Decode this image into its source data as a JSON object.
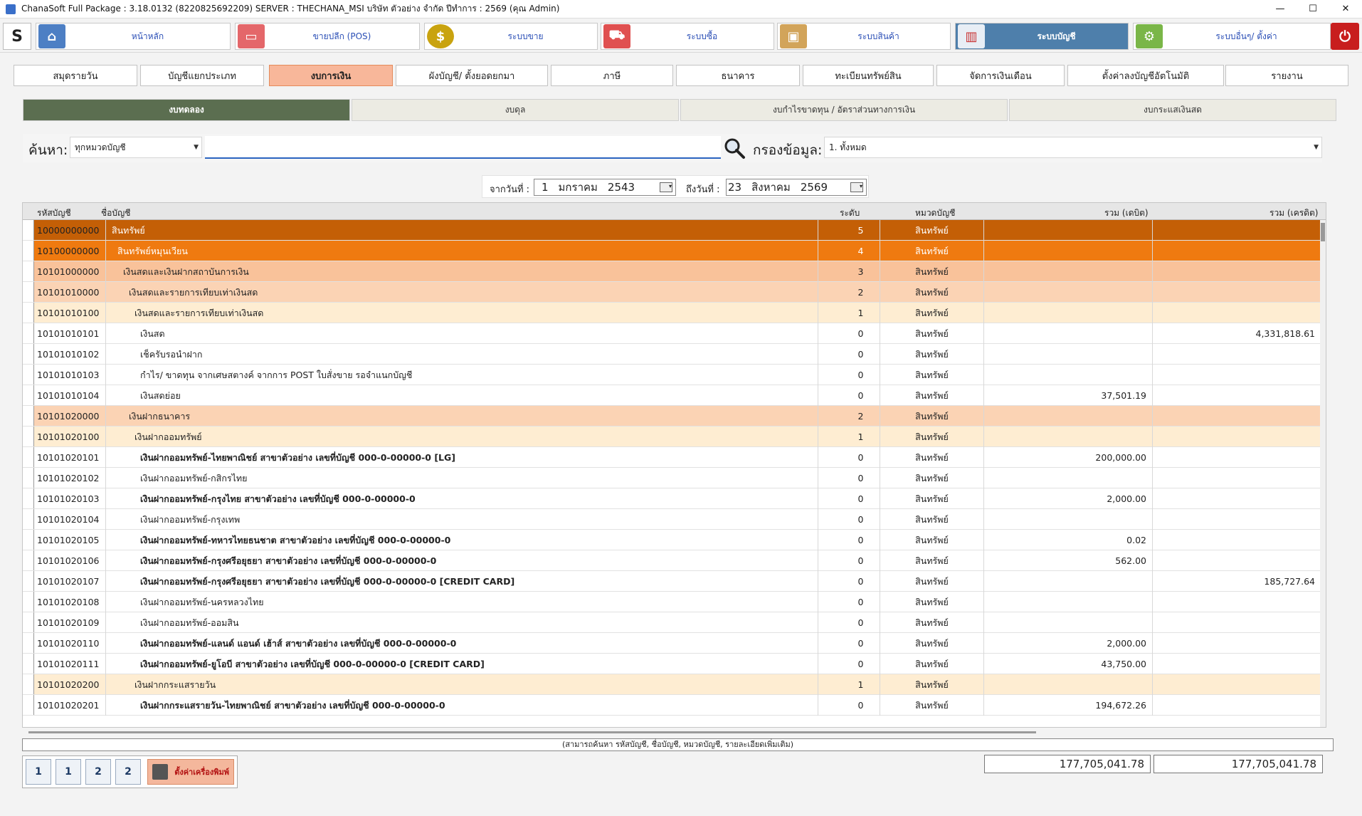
{
  "window": {
    "title": "ChanaSoft Full Package : 3.18.0132 (8220825692209) SERVER : THECHANA_MSI บริษัท ตัวอย่าง จำกัด ปีทำการ : 2569 (คุณ Admin)",
    "min": "—",
    "max": "☐",
    "close": "✕"
  },
  "modules": [
    {
      "label": "หน้าหลัก",
      "icon": "home-icon",
      "color": "#4d7fc4"
    },
    {
      "label": "ขายปลีก (POS)",
      "icon": "pos-terminal-icon",
      "color": "#e4676a"
    },
    {
      "label": "ระบบขาย",
      "icon": "dollar-coin-icon",
      "color": "#c9a30f"
    },
    {
      "label": "ระบบซื้อ",
      "icon": "shopping-cart-icon",
      "color": "#e05050"
    },
    {
      "label": "ระบบสินค้า",
      "icon": "box-icon",
      "color": "#d2a45a"
    },
    {
      "label": "ระบบบัญชี",
      "icon": "report-chart-icon",
      "color": "#e8eef5"
    },
    {
      "label": "ระบบอื่นๆ/ ตั้งค่า",
      "icon": "gear-icon",
      "color": "#7ab648"
    }
  ],
  "subtabs": [
    "สมุดรายวัน",
    "บัญชีแยกประเภท",
    "งบการเงิน",
    "ผังบัญชี/ ตั้งยอดยกมา",
    "ภาษี",
    "ธนาคาร",
    "ทะเบียนทรัพย์สิน",
    "จัดการเงินเดือน",
    "ตั้งค่าลงบัญชีอัตโนมัติ",
    "รายงาน"
  ],
  "report_tabs": [
    "งบทดลอง",
    "งบดุล",
    "งบกำไรขาดทุน / อัตราส่วนทางการเงิน",
    "งบกระแสเงินสด"
  ],
  "search": {
    "label": "ค้นหา:",
    "category": "ทุกหมวดบัญชี",
    "value": "",
    "filter_label": "กรองข้อมูล:",
    "filter_value": "1. ทั้งหมด"
  },
  "date_range": {
    "from_label": "จากวันที่ :",
    "from": {
      "day": "1",
      "month": "มกราคม",
      "year": "2543"
    },
    "to_label": "ถึงวันที่ :",
    "to": {
      "day": "23",
      "month": "สิงหาคม",
      "year": "2569"
    }
  },
  "grid": {
    "columns": [
      "รหัสบัญชี",
      "ชื่อบัญชี",
      "ระดับ",
      "หมวดบัญชี",
      "รวม (เดบิต)",
      "รวม (เครดิต)"
    ],
    "rows": [
      {
        "code": "10000000000",
        "name": "สินทรัพย์",
        "level": "5",
        "cat": "สินทรัพย์",
        "debit": "",
        "credit": "",
        "bold": false
      },
      {
        "code": "10100000000",
        "name": "สินทรัพย์หมุนเวียน",
        "level": "4",
        "cat": "สินทรัพย์",
        "debit": "",
        "credit": "",
        "bold": false
      },
      {
        "code": "10101000000",
        "name": "เงินสดและเงินฝากสถาบันการเงิน",
        "level": "3",
        "cat": "สินทรัพย์",
        "debit": "",
        "credit": "",
        "bold": false
      },
      {
        "code": "10101010000",
        "name": "เงินสดและรายการเทียบเท่าเงินสด",
        "level": "2",
        "cat": "สินทรัพย์",
        "debit": "",
        "credit": "",
        "bold": false
      },
      {
        "code": "10101010100",
        "name": "เงินสดและรายการเทียบเท่าเงินสด",
        "level": "1",
        "cat": "สินทรัพย์",
        "debit": "",
        "credit": "",
        "bold": false
      },
      {
        "code": "10101010101",
        "name": "เงินสด",
        "level": "0",
        "cat": "สินทรัพย์",
        "debit": "",
        "credit": "4,331,818.61",
        "bold": false
      },
      {
        "code": "10101010102",
        "name": "เช็ครับรอนำฝาก",
        "level": "0",
        "cat": "สินทรัพย์",
        "debit": "",
        "credit": "",
        "bold": false
      },
      {
        "code": "10101010103",
        "name": "กำไร/ ขาดทุน จากเศษสตางค์ จากการ POST ใบสั่งขาย รอจำแนกบัญชี",
        "level": "0",
        "cat": "สินทรัพย์",
        "debit": "",
        "credit": "",
        "bold": false
      },
      {
        "code": "10101010104",
        "name": "เงินสดย่อย",
        "level": "0",
        "cat": "สินทรัพย์",
        "debit": "37,501.19",
        "credit": "",
        "bold": false
      },
      {
        "code": "10101020000",
        "name": "เงินฝากธนาคาร",
        "level": "2",
        "cat": "สินทรัพย์",
        "debit": "",
        "credit": "",
        "bold": false
      },
      {
        "code": "10101020100",
        "name": "เงินฝากออมทรัพย์",
        "level": "1",
        "cat": "สินทรัพย์",
        "debit": "",
        "credit": "",
        "bold": false
      },
      {
        "code": "10101020101",
        "name": "เงินฝากออมทรัพย์-ไทยพาณิชย์ สาขาตัวอย่าง เลขที่บัญชี 000-0-00000-0 [LG]",
        "level": "0",
        "cat": "สินทรัพย์",
        "debit": "200,000.00",
        "credit": "",
        "bold": true
      },
      {
        "code": "10101020102",
        "name": "เงินฝากออมทรัพย์-กสิกรไทย",
        "level": "0",
        "cat": "สินทรัพย์",
        "debit": "",
        "credit": "",
        "bold": false
      },
      {
        "code": "10101020103",
        "name": "เงินฝากออมทรัพย์-กรุงไทย สาขาตัวอย่าง เลขที่บัญชี 000-0-00000-0",
        "level": "0",
        "cat": "สินทรัพย์",
        "debit": "2,000.00",
        "credit": "",
        "bold": true
      },
      {
        "code": "10101020104",
        "name": "เงินฝากออมทรัพย์-กรุงเทพ",
        "level": "0",
        "cat": "สินทรัพย์",
        "debit": "",
        "credit": "",
        "bold": false
      },
      {
        "code": "10101020105",
        "name": "เงินฝากออมทรัพย์-ทหารไทยธนชาต สาขาตัวอย่าง เลขที่บัญชี 000-0-00000-0",
        "level": "0",
        "cat": "สินทรัพย์",
        "debit": "0.02",
        "credit": "",
        "bold": true
      },
      {
        "code": "10101020106",
        "name": "เงินฝากออมทรัพย์-กรุงศรีอยุธยา สาขาตัวอย่าง เลขที่บัญชี 000-0-00000-0",
        "level": "0",
        "cat": "สินทรัพย์",
        "debit": "562.00",
        "credit": "",
        "bold": true
      },
      {
        "code": "10101020107",
        "name": "เงินฝากออมทรัพย์-กรุงศรีอยุธยา สาขาตัวอย่าง เลขที่บัญชี 000-0-00000-0 [CREDIT CARD]",
        "level": "0",
        "cat": "สินทรัพย์",
        "debit": "",
        "credit": "185,727.64",
        "bold": true
      },
      {
        "code": "10101020108",
        "name": "เงินฝากออมทรัพย์-นครหลวงไทย",
        "level": "0",
        "cat": "สินทรัพย์",
        "debit": "",
        "credit": "",
        "bold": false
      },
      {
        "code": "10101020109",
        "name": "เงินฝากออมทรัพย์-ออมสิน",
        "level": "0",
        "cat": "สินทรัพย์",
        "debit": "",
        "credit": "",
        "bold": false
      },
      {
        "code": "10101020110",
        "name": "เงินฝากออมทรัพย์-แลนด์ แอนด์ เฮ้าส์ สาขาตัวอย่าง เลขที่บัญชี 000-0-00000-0",
        "level": "0",
        "cat": "สินทรัพย์",
        "debit": "2,000.00",
        "credit": "",
        "bold": true
      },
      {
        "code": "10101020111",
        "name": "เงินฝากออมทรัพย์-ยูโอบี สาขาตัวอย่าง เลขที่บัญชี 000-0-00000-0 [CREDIT CARD]",
        "level": "0",
        "cat": "สินทรัพย์",
        "debit": "43,750.00",
        "credit": "",
        "bold": true
      },
      {
        "code": "10101020200",
        "name": "เงินฝากกระแสรายวัน",
        "level": "1",
        "cat": "สินทรัพย์",
        "debit": "",
        "credit": "",
        "bold": false
      },
      {
        "code": "10101020201",
        "name": "เงินฝากกระแสรายวัน-ไทยพาณิชย์ สาขาตัวอย่าง เลขที่บัญชี 000-0-00000-0",
        "level": "0",
        "cat": "สินทรัพย์",
        "debit": "194,672.26",
        "credit": "",
        "bold": true
      }
    ]
  },
  "hint": "(สามารถค้นหา รหัสบัญชี, ชื่อบัญชี, หมวดบัญชี, รายละเอียดเพิ่มเติม)",
  "toolbar": {
    "buttons": [
      "1",
      "1",
      "2",
      "2"
    ],
    "print_settings": "ตั้งค่าเครื่องพิมพ์"
  },
  "totals": {
    "debit": "177,705,041.78",
    "credit": "177,705,041.78"
  }
}
